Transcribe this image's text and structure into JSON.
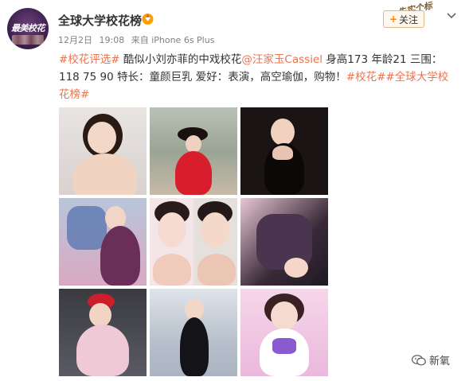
{
  "user": {
    "name": "全球大学校花榜",
    "avatar_text": "最美校花"
  },
  "meta": {
    "date": "12月2日",
    "time": "19:08",
    "source": "来自 iPhone 6s Plus"
  },
  "follow": {
    "label": "关注",
    "deco_text": "先实个标"
  },
  "post": {
    "tag1": "#校花评选#",
    "text1": " 酷似小刘亦菲的中戏校花",
    "mention": "@汪家玉Cassiel",
    "text2": " 身高173 年龄21 三围：118 75 90 特长：童颜巨乳 爱好：表演，高空瑜伽，购物！",
    "tag2": "#校花#",
    "tag3": "#全球大学校花榜#"
  },
  "watermark": {
    "label": "新氧"
  },
  "colors": {
    "accent": "#eb7350",
    "follow_plus": "#ff8200"
  }
}
